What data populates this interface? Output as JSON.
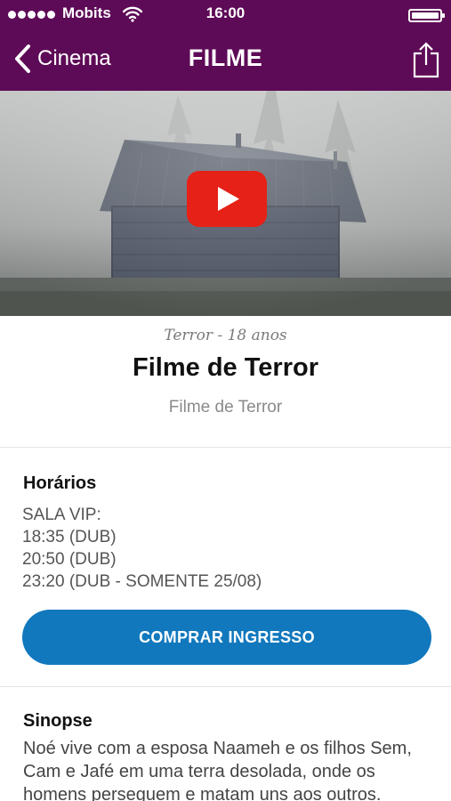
{
  "status_bar": {
    "carrier": "Mobits",
    "time": "16:00"
  },
  "nav": {
    "back_label": "Cinema",
    "title": "FILME"
  },
  "movie": {
    "genre_rating": "Terror - 18 anos",
    "title": "Filme de Terror",
    "original_title": "Filme de Terror"
  },
  "showtimes": {
    "heading": "Horários",
    "lines": [
      "SALA VIP:",
      "18:35 (DUB)",
      "20:50 (DUB)",
      "23:20 (DUB - SOMENTE 25/08)"
    ]
  },
  "buy_button": {
    "label": "COMPRAR INGRESSO"
  },
  "synopsis": {
    "heading": "Sinopse",
    "text": "Noé vive com a esposa Naameh e os filhos Sem, Cam e Jafé em uma terra desolada, onde os homens perseguem e matam uns aos outros."
  },
  "icons": {
    "back": "chevron-left-icon",
    "share": "share-icon",
    "play": "youtube-play-icon",
    "wifi": "wifi-icon",
    "battery": "battery-icon"
  },
  "colors": {
    "brand": "#5e0b57",
    "button": "#1178bd",
    "youtube_red": "#e62117"
  }
}
